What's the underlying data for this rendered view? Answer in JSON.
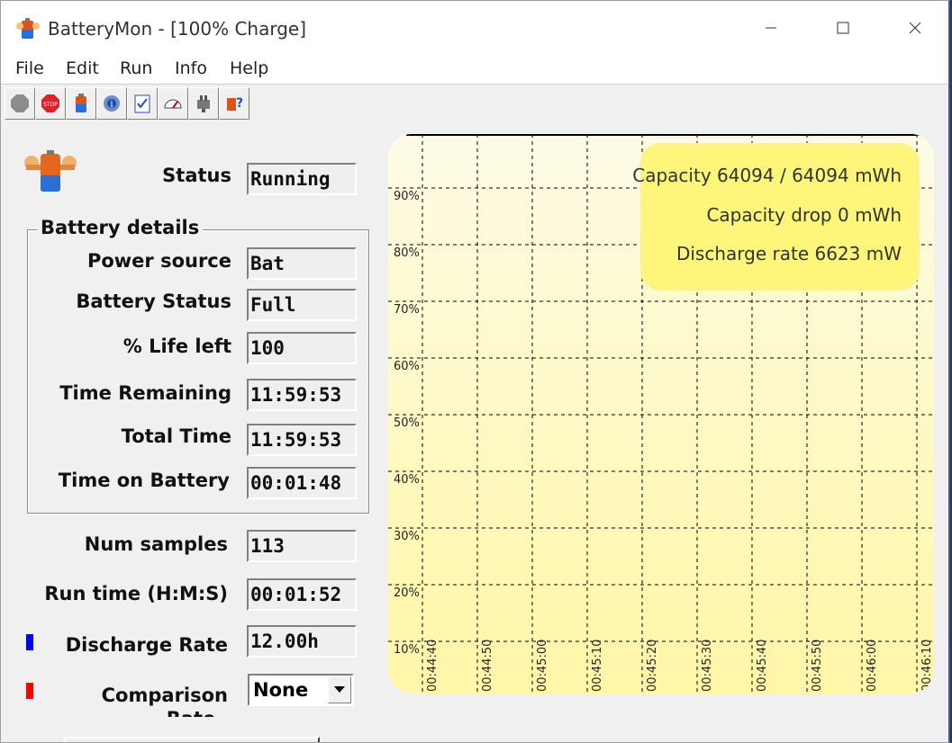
{
  "window": {
    "title": "BatteryMon - [100% Charge]"
  },
  "menu": [
    "File",
    "Edit",
    "Run",
    "Info",
    "Help"
  ],
  "toolbar": {
    "icons": [
      "stop-gray-icon",
      "stop-sign-icon",
      "battery-icon",
      "gear-info-icon",
      "checklist-icon",
      "gauge-icon",
      "plug-icon",
      "help-person-icon"
    ]
  },
  "status": {
    "label": "Status",
    "value": "Running"
  },
  "battery_details": {
    "title": "Battery details",
    "fields": [
      {
        "label": "Power source",
        "value": "Bat"
      },
      {
        "label": "Battery Status",
        "value": "Full"
      },
      {
        "label": "% Life left",
        "value": "100"
      },
      {
        "label": "Time Remaining",
        "value": "11:59:53"
      },
      {
        "label": "Total Time",
        "value": "11:59:53"
      },
      {
        "label": "Time on Battery",
        "value": "00:01:48"
      }
    ]
  },
  "stats": {
    "num_samples": {
      "label": "Num samples",
      "value": "113"
    },
    "run_time": {
      "label": "Run time (H:M:S)",
      "value": "00:01:52"
    },
    "discharge_rate": {
      "label": "Discharge Rate",
      "value": "12.00h",
      "color": "#0000ff"
    },
    "comparison": {
      "label": "Comparison",
      "label_cont": "Rate",
      "value": "None",
      "color": "#ff0000"
    }
  },
  "chart_data": {
    "type": "line",
    "y_ticks": [
      "90%",
      "80%",
      "70%",
      "60%",
      "50%",
      "40%",
      "30%",
      "20%",
      "10%"
    ],
    "x_ticks": [
      "00:44:40",
      "00:44:50",
      "00:45:00",
      "00:45:10",
      "00:45:20",
      "00:45:30",
      "00:45:40",
      "00:45:50",
      "00:46:00",
      "00:46:10"
    ],
    "grid": true,
    "legend": {
      "capacity": "Capacity 64094 / 64094 mWh",
      "capacity_drop": "Capacity drop 0 mWh",
      "discharge_rate": "Discharge rate 6623 mW"
    },
    "series": [
      {
        "color": "#0000ff",
        "values": [
          100,
          100,
          100,
          100,
          100,
          100,
          100,
          100,
          100,
          100
        ]
      }
    ],
    "background": "#fff8b8"
  }
}
